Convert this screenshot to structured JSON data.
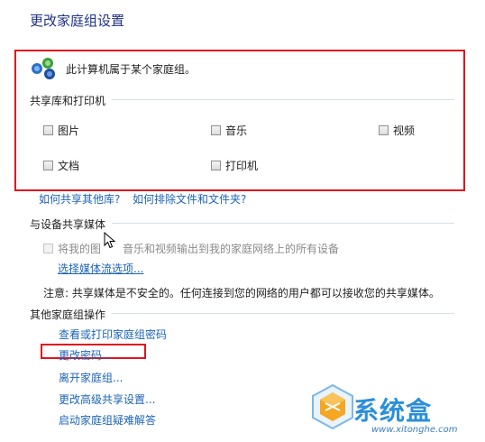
{
  "page_title": "更改家庭组设置",
  "homegroup_status": "此计算机属于某个家庭组。",
  "libraries_section": {
    "label": "共享库和打印机",
    "items": [
      {
        "label": "图片",
        "checked": false
      },
      {
        "label": "音乐",
        "checked": false
      },
      {
        "label": "视频",
        "checked": false
      },
      {
        "label": "文档",
        "checked": false
      },
      {
        "label": "打印机",
        "checked": false
      }
    ]
  },
  "help_links": {
    "share_other_libs": "如何共享其他库?",
    "exclude_files": "如何排除文件和文件夹?"
  },
  "media_section": {
    "label": "与设备共享媒体",
    "checkbox_label_pre": "将我的图",
    "checkbox_label_post": "音乐和视频输出到我的家庭网络上的所有设备",
    "stream_options_link": "选择媒体流选项...",
    "note": "注意: 共享媒体是不安全的。任何连接到您的网络的用户都可以接收您的共享媒体。"
  },
  "other_actions": {
    "label": "其他家庭组操作",
    "links": [
      "查看或打印家庭组密码",
      "更改密码...",
      "离开家庭组...",
      "更改高级共享设置...",
      "启动家庭组疑难解答"
    ]
  },
  "watermark": {
    "text": "系统盒",
    "url": "www.xitonghe.com"
  },
  "colors": {
    "title": "#1e3287",
    "link": "#1c63b7",
    "highlight_box": "#e0141e"
  }
}
